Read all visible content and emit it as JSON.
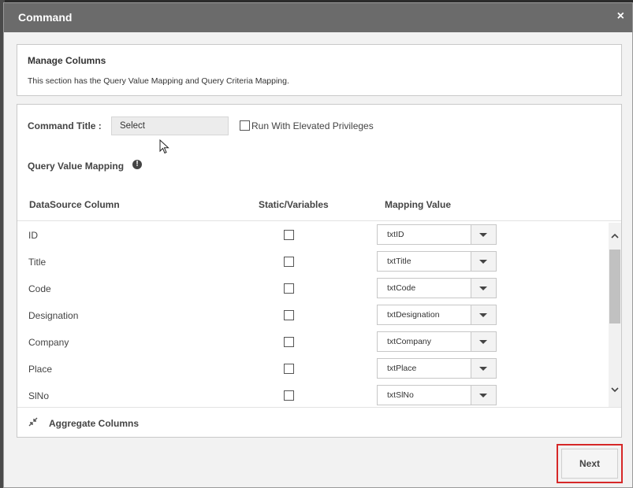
{
  "modal": {
    "title": "Command",
    "close_glyph": "×"
  },
  "manage": {
    "title": "Manage Columns",
    "description": "This section has the Query Value Mapping and Query Criteria Mapping."
  },
  "command": {
    "title_label": "Command Title :",
    "title_value": "Select",
    "elevated_label": "Run With Elevated Privileges",
    "elevated_checked": false
  },
  "query_value_mapping": {
    "label": "Query Value Mapping",
    "info_glyph": "!",
    "headers": {
      "datasource": "DataSource Column",
      "static": "Static/Variables",
      "mapping": "Mapping Value"
    },
    "rows": [
      {
        "name": "ID",
        "static": false,
        "mapping": "txtID"
      },
      {
        "name": "Title",
        "static": false,
        "mapping": "txtTitle"
      },
      {
        "name": "Code",
        "static": false,
        "mapping": "txtCode"
      },
      {
        "name": "Designation",
        "static": false,
        "mapping": "txtDesignation"
      },
      {
        "name": "Company",
        "static": false,
        "mapping": "txtCompany"
      },
      {
        "name": "Place",
        "static": false,
        "mapping": "txtPlace"
      },
      {
        "name": "SlNo",
        "static": false,
        "mapping": "txtSlNo"
      }
    ]
  },
  "aggregate": {
    "label": "Aggregate Columns"
  },
  "footer": {
    "next_label": "Next"
  },
  "icons": {
    "close": "close-icon",
    "info": "info-icon",
    "caret": "chevron-down-icon",
    "aggregate": "collapse-arrows-icon",
    "cursor": "mouse-pointer-icon"
  },
  "colors": {
    "header_bg": "#6b6b6b",
    "highlight": "#d62828"
  }
}
